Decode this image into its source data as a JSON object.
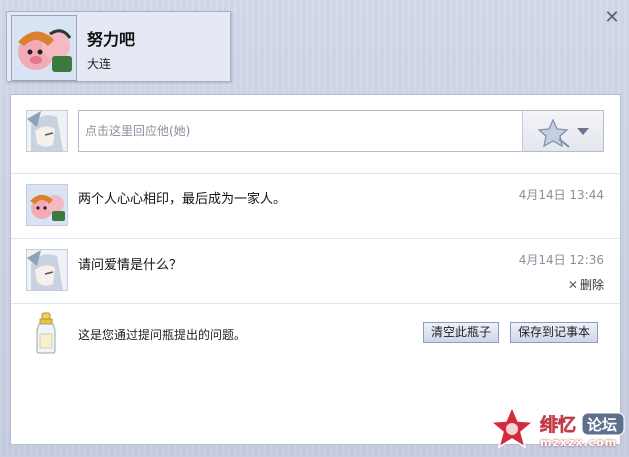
{
  "header": {
    "user_name": "努力吧",
    "location": "大连",
    "close_glyph": "✕"
  },
  "reply": {
    "placeholder": "点击这里回应他(她)"
  },
  "messages": [
    {
      "text": "两个人心心相印，最后成为一家人。",
      "time": "4月14日 13:44"
    },
    {
      "text": "请问爱情是什么？",
      "time": "4月14日 12:36",
      "delete_label": "删除"
    }
  ],
  "footer": {
    "text": "这是您通过提问瓶提出的问题。",
    "clear_button": "清空此瓶子",
    "save_button": "保存到记事本"
  },
  "watermark": {
    "forum_label": "论坛",
    "site_label": "mzxzx.com"
  },
  "colors": {
    "frame_bg": "#c8cfe0",
    "card_bg": "#e6e9f4",
    "button_border": "#8f9bbd",
    "time_text": "#8a8f9c"
  }
}
